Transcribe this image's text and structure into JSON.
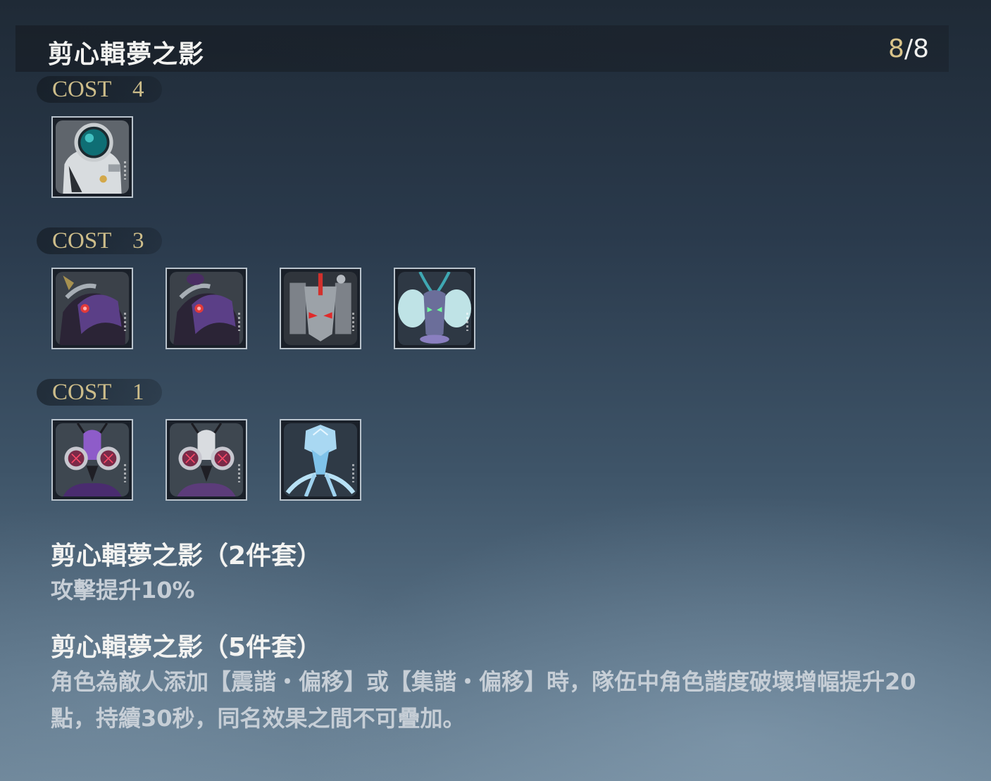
{
  "header": {
    "title": "剪心輯夢之影",
    "count_current": "8",
    "count_sep_total": "/8"
  },
  "cost_groups": [
    {
      "label": "COST",
      "value": "4",
      "echoes": [
        "astronaut-echo-icon"
      ]
    },
    {
      "label": "COST",
      "value": "3",
      "echoes": [
        "purple-beast-echo-icon",
        "purple-beast-echo-icon",
        "mech-beast-echo-icon",
        "frost-horned-echo-icon"
      ]
    },
    {
      "label": "COST",
      "value": "1",
      "echoes": [
        "purple-insect-echo-icon",
        "white-insect-echo-icon",
        "ice-crystal-echo-icon"
      ]
    }
  ],
  "set_bonuses": [
    {
      "title": "剪心輯夢之影（2件套）",
      "desc": "攻擊提升10%"
    },
    {
      "title": "剪心輯夢之影（5件套）",
      "desc": "角色為敵人添加【震諧・偏移】或【集諧・偏移】時，隊伍中角色諧度破壞增幅提升20點，持續30秒，同名效果之間不可疊加。"
    }
  ],
  "colors": {
    "cost_text": "#cdbd8a",
    "count_accent": "#d9c48a",
    "title_text": "#f3f3f1",
    "desc_text": "#c6ced6"
  }
}
